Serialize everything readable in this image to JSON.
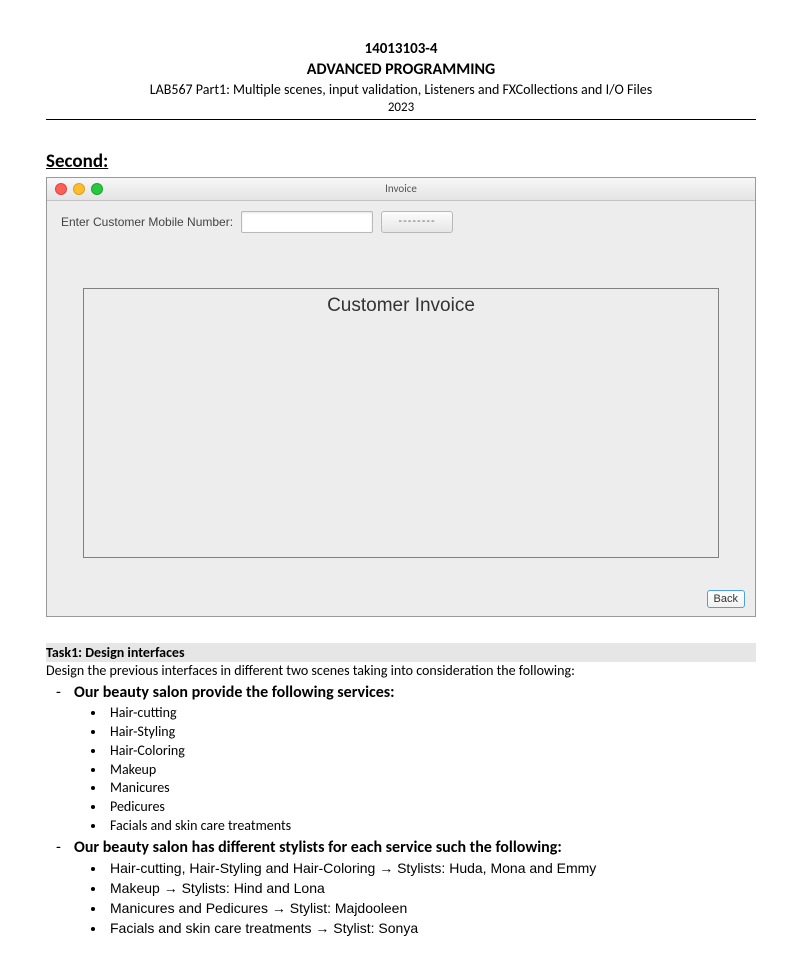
{
  "header": {
    "code": "14013103-4",
    "title": "ADVANCED PROGRAMMING",
    "subtitle": "LAB567 Part1: Multiple scenes, input validation, Listeners and FXCollections and I/O Files",
    "year": "2023"
  },
  "section_label": "Second:",
  "win": {
    "title": "Invoice",
    "input_label": "Enter Customer Mobile Number:",
    "button_label": "--------",
    "invoice_title": "Customer Invoice",
    "back_label": "Back"
  },
  "task": {
    "heading": "Task1: Design interfaces",
    "intro": "Design the previous interfaces in different two scenes taking into consideration the following:",
    "services_heading": "Our beauty salon provide the following services:",
    "services": [
      "Hair-cutting",
      "Hair-Styling",
      "Hair-Coloring",
      "Makeup",
      "Manicures",
      "Pedicures",
      "Facials and skin care treatments"
    ],
    "stylists_heading": "Our beauty salon has different stylists for each service such the following:",
    "stylists": [
      "Hair-cutting, Hair-Styling and Hair-Coloring → Stylists: Huda, Mona and Emmy",
      "Makeup → Stylists: Hind and Lona",
      "Manicures and Pedicures → Stylist: Majdooleen",
      "Facials and skin care treatments → Stylist: Sonya"
    ]
  }
}
